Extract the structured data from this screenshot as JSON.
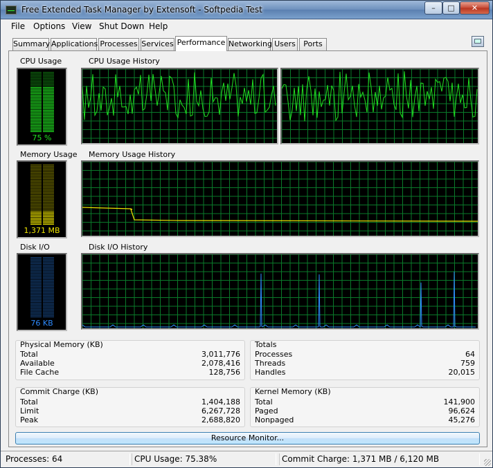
{
  "window": {
    "title": "Free Extended Task Manager by Extensoft - Softpedia Test",
    "minimize": "–",
    "maximize": "□",
    "close": "✕",
    "app_icon": "task-manager-icon"
  },
  "menu": [
    "File",
    "Options",
    "View",
    "Shut Down",
    "Help"
  ],
  "tabs": [
    "Summary",
    "Applications",
    "Processes",
    "Services",
    "Performance",
    "Networking",
    "Users",
    "Ports"
  ],
  "active_tab": "Performance",
  "cpu": {
    "label": "CPU Usage",
    "history_label": "CPU Usage History",
    "value": "75 %",
    "level": 0.75,
    "color": "#21e221"
  },
  "memory": {
    "label": "Memory Usage",
    "history_label": "Memory Usage History",
    "value": "1,371 MB",
    "level": 0.22,
    "color": "#f0e600"
  },
  "disk": {
    "label": "Disk I/O",
    "history_label": "Disk I/O History",
    "value": "76 KB",
    "level": 0.0,
    "color": "#2e8bff"
  },
  "graph_colors": {
    "grid": "#0a7a2a",
    "background": "#000000"
  },
  "physical_memory": {
    "title": "Physical Memory (KB)",
    "rows": [
      {
        "k": "Total",
        "v": "3,011,776"
      },
      {
        "k": "Available",
        "v": "2,078,416"
      },
      {
        "k": "File Cache",
        "v": "128,756"
      }
    ]
  },
  "totals": {
    "title": "Totals",
    "rows": [
      {
        "k": "Processes",
        "v": "64"
      },
      {
        "k": "Threads",
        "v": "759"
      },
      {
        "k": "Handles",
        "v": "20,015"
      }
    ]
  },
  "commit_charge": {
    "title": "Commit Charge (KB)",
    "rows": [
      {
        "k": "Total",
        "v": "1,404,188"
      },
      {
        "k": "Limit",
        "v": "6,267,728"
      },
      {
        "k": "Peak",
        "v": "2,688,820"
      }
    ]
  },
  "kernel_memory": {
    "title": "Kernel Memory (KB)",
    "rows": [
      {
        "k": "Total",
        "v": "141,900"
      },
      {
        "k": "Paged",
        "v": "96,624"
      },
      {
        "k": "Nonpaged",
        "v": "45,276"
      }
    ]
  },
  "resource_monitor_label": "Resource Monitor...",
  "status": {
    "processes": "Processes: 64",
    "cpu": "CPU Usage: 75.38%",
    "commit": "Commit Charge: 1,371 MB / 6,120 MB"
  }
}
